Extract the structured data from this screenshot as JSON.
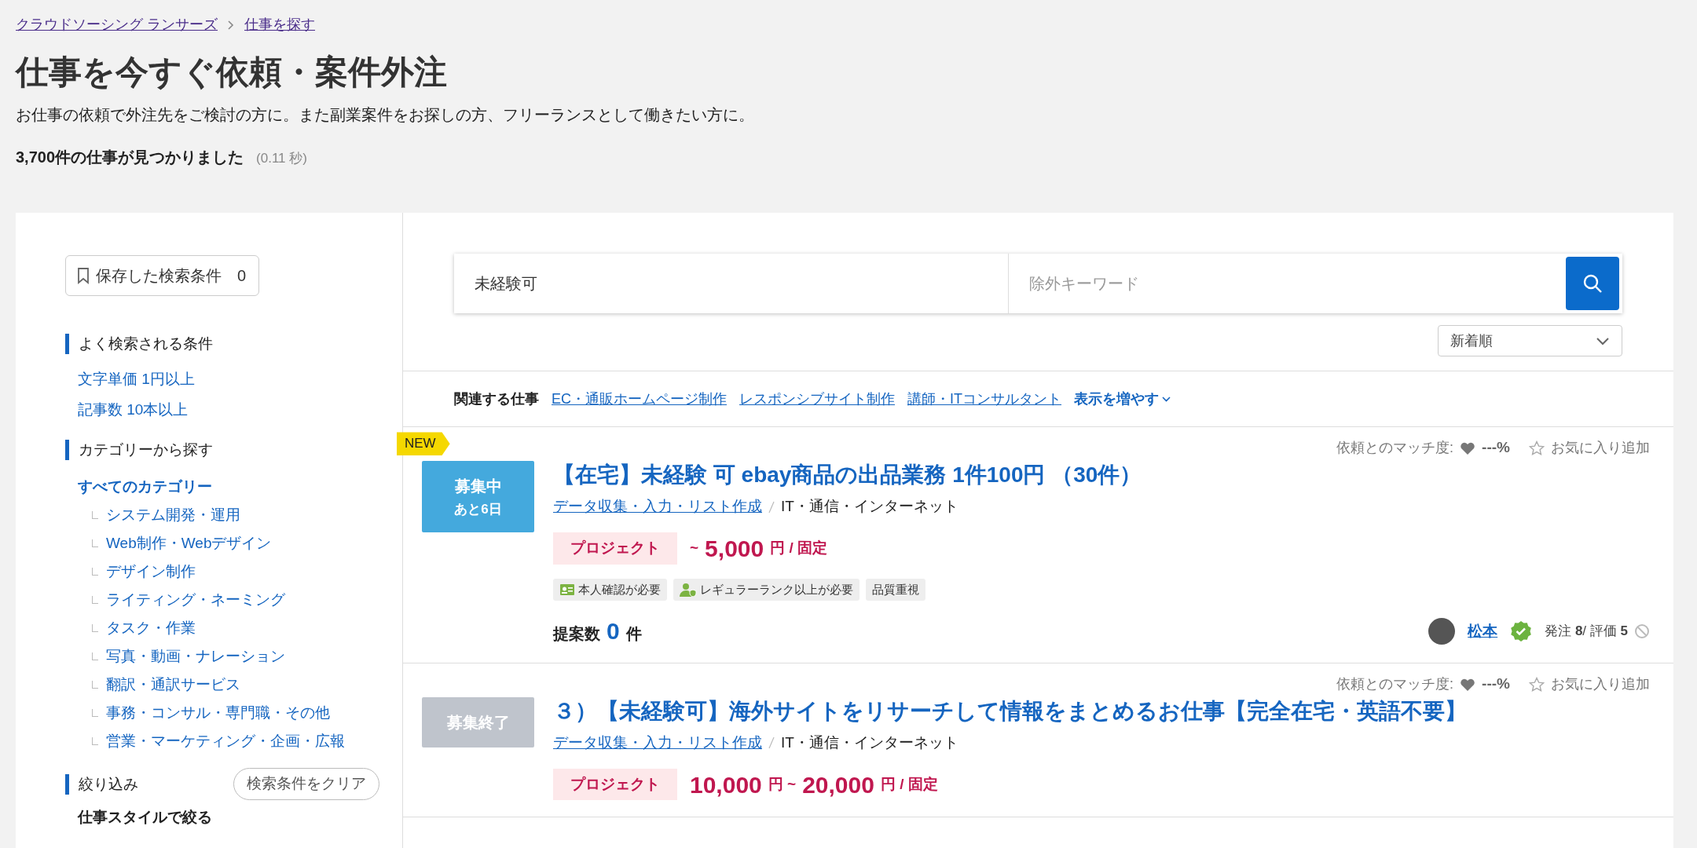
{
  "breadcrumb": [
    {
      "label": "クラウドソーシング ランサーズ"
    },
    {
      "label": "仕事を探す"
    }
  ],
  "heading": "仕事を今すぐ依頼・案件外注",
  "description": "お仕事の依頼で外注先をご検討の方に。また副業案件をお探しの方、フリーランスとして働きたい方に。",
  "result": {
    "count": "3,700件の仕事が見つかりました",
    "time": "(0.11 秒)"
  },
  "sidebar": {
    "saved_button": {
      "label": "保存した検索条件",
      "count": "0"
    },
    "popular": {
      "title": "よく検索される条件",
      "links": [
        "文字単価 1円以上",
        "記事数 10本以上"
      ]
    },
    "categories": {
      "title": "カテゴリーから探す",
      "items": [
        {
          "label": "すべてのカテゴリー",
          "selected": true,
          "children": [
            {
              "label": "システム開発・運用",
              "selected": false
            },
            {
              "label": "Web制作・Webデザイン",
              "selected": false
            },
            {
              "label": "デザイン制作",
              "selected": false
            },
            {
              "label": "ライティング・ネーミング",
              "selected": false
            },
            {
              "label": "タスク・作業",
              "selected": false
            },
            {
              "label": "写真・動画・ナレーション",
              "selected": false
            },
            {
              "label": "翻訳・通訳サービス",
              "selected": false
            },
            {
              "label": "事務・コンサル・専門職・その他",
              "selected": false
            },
            {
              "label": "営業・マーケティング・企画・広報",
              "selected": false
            }
          ]
        }
      ]
    },
    "filter": {
      "title": "絞り込み",
      "clear_button": "検索条件をクリア",
      "subtitle": "仕事スタイルで絞る"
    }
  },
  "search": {
    "keyword": "未経験可",
    "exclude_placeholder": "除外キーワード",
    "sort": "新着順"
  },
  "related": {
    "label": "関連する仕事",
    "links": [
      "EC・通販ホームページ制作",
      "レスポンシブサイト制作",
      "講師・ITコンサルタント"
    ],
    "more": "表示を増やす"
  },
  "jobs": [
    {
      "is_new": true,
      "new_label": "NEW",
      "status": {
        "kind": "open",
        "lines": [
          "募集中",
          "あと6日"
        ]
      },
      "match_label": "依頼とのマッチ度:",
      "match_value": "---%",
      "favorite": "お気に入り追加",
      "title": "【在宅】未経験 可 ebay商品の出品業務 1件100円 （30件）",
      "category": "データ収集・入力・リスト作成",
      "subcategory": "IT・通信・インターネット",
      "type": "プロジェクト",
      "price": [
        {
          "kind": "unit",
          "text": "~"
        },
        {
          "kind": "amount",
          "text": "5,000"
        },
        {
          "kind": "unit",
          "text": "円 / 固定"
        }
      ],
      "tags": [
        {
          "kind": "identity",
          "label": "本人確認が必要"
        },
        {
          "kind": "rank",
          "label": "レギュラーランク以上が必要"
        },
        {
          "kind": "plain",
          "label": "品質重視"
        }
      ],
      "proposals": {
        "label": "提案数",
        "count": "0",
        "unit": "件"
      },
      "client": {
        "name": "松本",
        "verified": true,
        "stats": "発注 **8**/ 評価 **5**"
      }
    },
    {
      "is_new": false,
      "status": {
        "kind": "closed",
        "lines": [
          "募集終了"
        ]
      },
      "match_label": "依頼とのマッチ度:",
      "match_value": "---%",
      "favorite": "お気に入り追加",
      "title": "３）【未経験可】海外サイトをリサーチして情報をまとめるお仕事【完全在宅・英語不要】",
      "category": "データ収集・入力・リスト作成",
      "subcategory": "IT・通信・インターネット",
      "type": "プロジェクト",
      "price": [
        {
          "kind": "amount",
          "text": "10,000"
        },
        {
          "kind": "unit",
          "text": "円 ~"
        },
        {
          "kind": "amount",
          "text": "20,000"
        },
        {
          "kind": "unit",
          "text": "円 / 固定"
        }
      ]
    }
  ]
}
